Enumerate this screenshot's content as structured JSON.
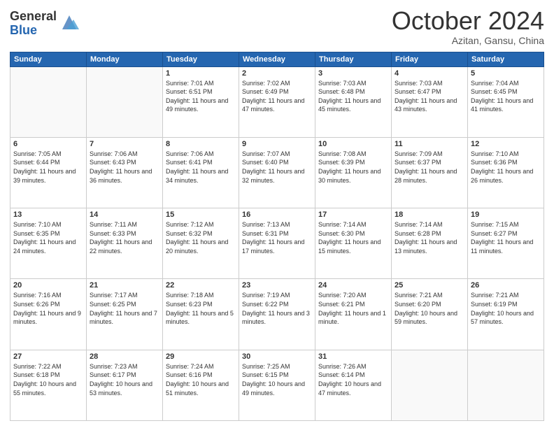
{
  "header": {
    "logo_general": "General",
    "logo_blue": "Blue",
    "month_title": "October 2024",
    "subtitle": "Azitan, Gansu, China"
  },
  "days_of_week": [
    "Sunday",
    "Monday",
    "Tuesday",
    "Wednesday",
    "Thursday",
    "Friday",
    "Saturday"
  ],
  "weeks": [
    [
      {
        "day": "",
        "info": ""
      },
      {
        "day": "",
        "info": ""
      },
      {
        "day": "1",
        "info": "Sunrise: 7:01 AM\nSunset: 6:51 PM\nDaylight: 11 hours and 49 minutes."
      },
      {
        "day": "2",
        "info": "Sunrise: 7:02 AM\nSunset: 6:49 PM\nDaylight: 11 hours and 47 minutes."
      },
      {
        "day": "3",
        "info": "Sunrise: 7:03 AM\nSunset: 6:48 PM\nDaylight: 11 hours and 45 minutes."
      },
      {
        "day": "4",
        "info": "Sunrise: 7:03 AM\nSunset: 6:47 PM\nDaylight: 11 hours and 43 minutes."
      },
      {
        "day": "5",
        "info": "Sunrise: 7:04 AM\nSunset: 6:45 PM\nDaylight: 11 hours and 41 minutes."
      }
    ],
    [
      {
        "day": "6",
        "info": "Sunrise: 7:05 AM\nSunset: 6:44 PM\nDaylight: 11 hours and 39 minutes."
      },
      {
        "day": "7",
        "info": "Sunrise: 7:06 AM\nSunset: 6:43 PM\nDaylight: 11 hours and 36 minutes."
      },
      {
        "day": "8",
        "info": "Sunrise: 7:06 AM\nSunset: 6:41 PM\nDaylight: 11 hours and 34 minutes."
      },
      {
        "day": "9",
        "info": "Sunrise: 7:07 AM\nSunset: 6:40 PM\nDaylight: 11 hours and 32 minutes."
      },
      {
        "day": "10",
        "info": "Sunrise: 7:08 AM\nSunset: 6:39 PM\nDaylight: 11 hours and 30 minutes."
      },
      {
        "day": "11",
        "info": "Sunrise: 7:09 AM\nSunset: 6:37 PM\nDaylight: 11 hours and 28 minutes."
      },
      {
        "day": "12",
        "info": "Sunrise: 7:10 AM\nSunset: 6:36 PM\nDaylight: 11 hours and 26 minutes."
      }
    ],
    [
      {
        "day": "13",
        "info": "Sunrise: 7:10 AM\nSunset: 6:35 PM\nDaylight: 11 hours and 24 minutes."
      },
      {
        "day": "14",
        "info": "Sunrise: 7:11 AM\nSunset: 6:33 PM\nDaylight: 11 hours and 22 minutes."
      },
      {
        "day": "15",
        "info": "Sunrise: 7:12 AM\nSunset: 6:32 PM\nDaylight: 11 hours and 20 minutes."
      },
      {
        "day": "16",
        "info": "Sunrise: 7:13 AM\nSunset: 6:31 PM\nDaylight: 11 hours and 17 minutes."
      },
      {
        "day": "17",
        "info": "Sunrise: 7:14 AM\nSunset: 6:30 PM\nDaylight: 11 hours and 15 minutes."
      },
      {
        "day": "18",
        "info": "Sunrise: 7:14 AM\nSunset: 6:28 PM\nDaylight: 11 hours and 13 minutes."
      },
      {
        "day": "19",
        "info": "Sunrise: 7:15 AM\nSunset: 6:27 PM\nDaylight: 11 hours and 11 minutes."
      }
    ],
    [
      {
        "day": "20",
        "info": "Sunrise: 7:16 AM\nSunset: 6:26 PM\nDaylight: 11 hours and 9 minutes."
      },
      {
        "day": "21",
        "info": "Sunrise: 7:17 AM\nSunset: 6:25 PM\nDaylight: 11 hours and 7 minutes."
      },
      {
        "day": "22",
        "info": "Sunrise: 7:18 AM\nSunset: 6:23 PM\nDaylight: 11 hours and 5 minutes."
      },
      {
        "day": "23",
        "info": "Sunrise: 7:19 AM\nSunset: 6:22 PM\nDaylight: 11 hours and 3 minutes."
      },
      {
        "day": "24",
        "info": "Sunrise: 7:20 AM\nSunset: 6:21 PM\nDaylight: 11 hours and 1 minute."
      },
      {
        "day": "25",
        "info": "Sunrise: 7:21 AM\nSunset: 6:20 PM\nDaylight: 10 hours and 59 minutes."
      },
      {
        "day": "26",
        "info": "Sunrise: 7:21 AM\nSunset: 6:19 PM\nDaylight: 10 hours and 57 minutes."
      }
    ],
    [
      {
        "day": "27",
        "info": "Sunrise: 7:22 AM\nSunset: 6:18 PM\nDaylight: 10 hours and 55 minutes."
      },
      {
        "day": "28",
        "info": "Sunrise: 7:23 AM\nSunset: 6:17 PM\nDaylight: 10 hours and 53 minutes."
      },
      {
        "day": "29",
        "info": "Sunrise: 7:24 AM\nSunset: 6:16 PM\nDaylight: 10 hours and 51 minutes."
      },
      {
        "day": "30",
        "info": "Sunrise: 7:25 AM\nSunset: 6:15 PM\nDaylight: 10 hours and 49 minutes."
      },
      {
        "day": "31",
        "info": "Sunrise: 7:26 AM\nSunset: 6:14 PM\nDaylight: 10 hours and 47 minutes."
      },
      {
        "day": "",
        "info": ""
      },
      {
        "day": "",
        "info": ""
      }
    ]
  ]
}
